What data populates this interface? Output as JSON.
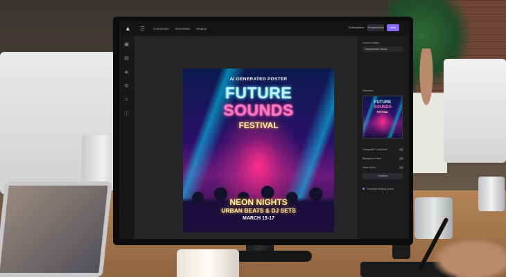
{
  "app": {
    "menu_tabs": [
      "Connection",
      "Generated",
      "Studios"
    ],
    "top_buttons": [
      "Subscription",
      "Perspectives",
      "New"
    ],
    "accent_color": "#8a6cff"
  },
  "poster": {
    "kicker": "AI GENERATED POSTER",
    "title_line1": "FUTURE",
    "title_line2": "SOUNDS",
    "subtitle": "FESTIVAL",
    "line_neon": "NEON NIGHTS",
    "line_urban": "URBAN BEATS & DJ SETS",
    "date": "MARCH 15-17"
  },
  "panel": {
    "section1_label": "Content Sliders",
    "select1_value": "Overgenerate Visuals",
    "section2_label": "Variations",
    "row1_label": "Composite Coordinate",
    "row2_label": "Background Item",
    "row3_label": "Inline Editor",
    "button_label": "Continue",
    "footer_label": "Generate Missing poster"
  },
  "icons": [
    "app-logo-icon",
    "menu-icon",
    "doc-icon",
    "page-icon",
    "layers-icon",
    "settings-icon",
    "crop-icon",
    "info-icon"
  ]
}
